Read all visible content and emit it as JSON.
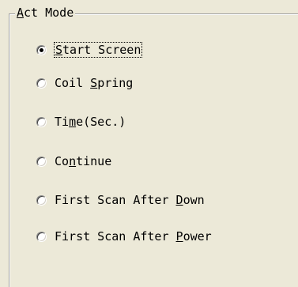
{
  "group": {
    "title_access_key": "A",
    "title_rest": "ct Mode"
  },
  "options": [
    {
      "before": "",
      "key": "S",
      "after": "tart Screen",
      "checked": true,
      "focused": true
    },
    {
      "before": "Coil ",
      "key": "S",
      "after": "pring",
      "checked": false,
      "focused": false
    },
    {
      "before": "Ti",
      "key": "m",
      "after": "e(Sec.)",
      "checked": false,
      "focused": false
    },
    {
      "before": "Co",
      "key": "n",
      "after": "tinue",
      "checked": false,
      "focused": false
    },
    {
      "before": "First Scan After ",
      "key": "D",
      "after": "own",
      "checked": false,
      "focused": false
    },
    {
      "before": "First Scan After ",
      "key": "P",
      "after": "ower",
      "checked": false,
      "focused": false
    }
  ]
}
